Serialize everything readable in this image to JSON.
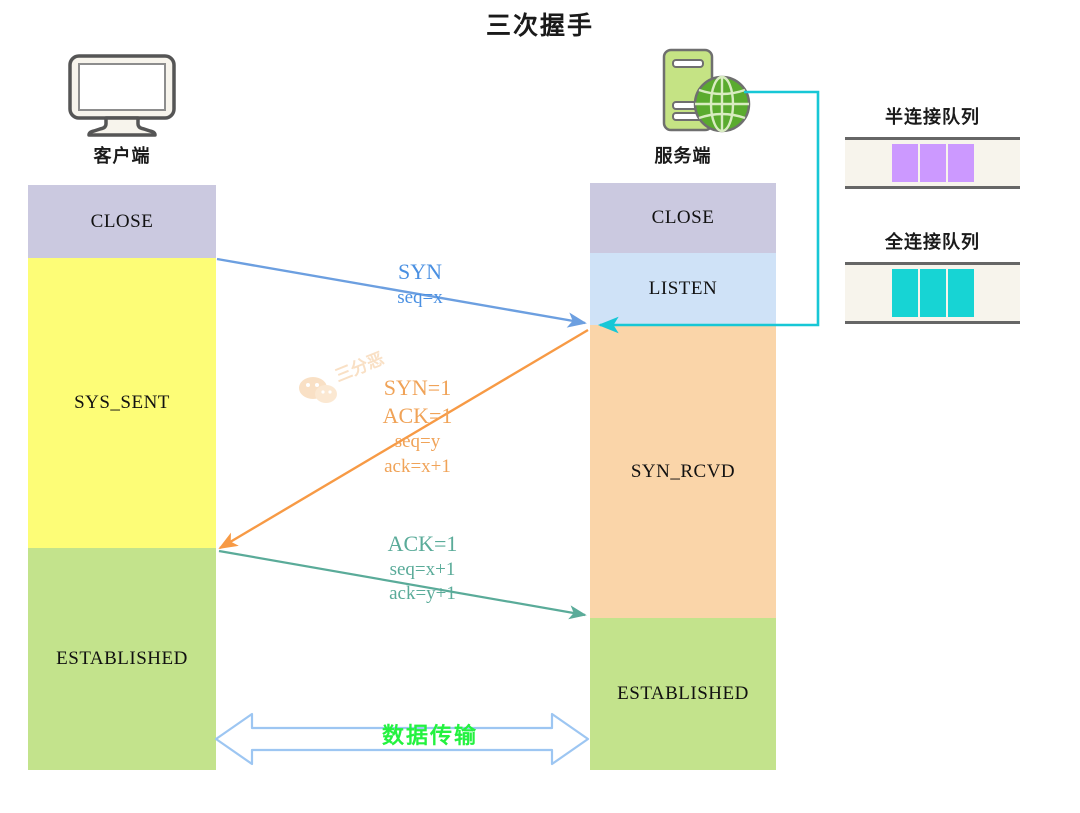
{
  "title": "三次握手",
  "endpoints": {
    "client": {
      "label": "客户端",
      "icon": "monitor-icon"
    },
    "server": {
      "label": "服务端",
      "icon": "server-globe-icon"
    }
  },
  "client_states": [
    {
      "name": "CLOSE",
      "color": "#cbc9e0"
    },
    {
      "name": "SYS_SENT",
      "color": "#fdfd77"
    },
    {
      "name": "ESTABLISHED",
      "color": "#c3e38c"
    }
  ],
  "server_states": [
    {
      "name": "CLOSE",
      "color": "#cbc9e0"
    },
    {
      "name": "LISTEN",
      "color": "#cfe2f7"
    },
    {
      "name": "SYN_RCVD",
      "color": "#fad5a9"
    },
    {
      "name": "ESTABLISHED",
      "color": "#c3e38c"
    }
  ],
  "messages": [
    {
      "id": "syn",
      "direction": "client-to-server",
      "color": "#4a90e2",
      "lines": [
        "SYN",
        "seq=x"
      ]
    },
    {
      "id": "syn-ack",
      "direction": "server-to-client",
      "color": "#f0a358",
      "lines": [
        "SYN=1",
        "ACK=1",
        "seq=y",
        "ack=x+1"
      ]
    },
    {
      "id": "ack",
      "direction": "client-to-server",
      "color": "#5aab99",
      "lines": [
        "ACK=1",
        "seq=x+1",
        "ack=y+1"
      ]
    }
  ],
  "data_transfer": {
    "label": "数据传输",
    "color": "#23f23f",
    "arrow_color": "#9dc6f2"
  },
  "queues": [
    {
      "id": "syn-queue",
      "title": "半连接队列",
      "cell_color": "#cc99ff",
      "cells": 3,
      "box_color": "#f7f4ec"
    },
    {
      "id": "accept-queue",
      "title": "全连接队列",
      "cell_color": "#17d4d4",
      "cells": 3,
      "box_color": "#f7f4ec"
    }
  ],
  "queue_link": {
    "color": "#17c7d6",
    "from": "server-icon",
    "to": "server-listen-boundary"
  },
  "watermark": {
    "text": "三分恶",
    "icon": "wechat-icon",
    "color": "#f5c896"
  }
}
